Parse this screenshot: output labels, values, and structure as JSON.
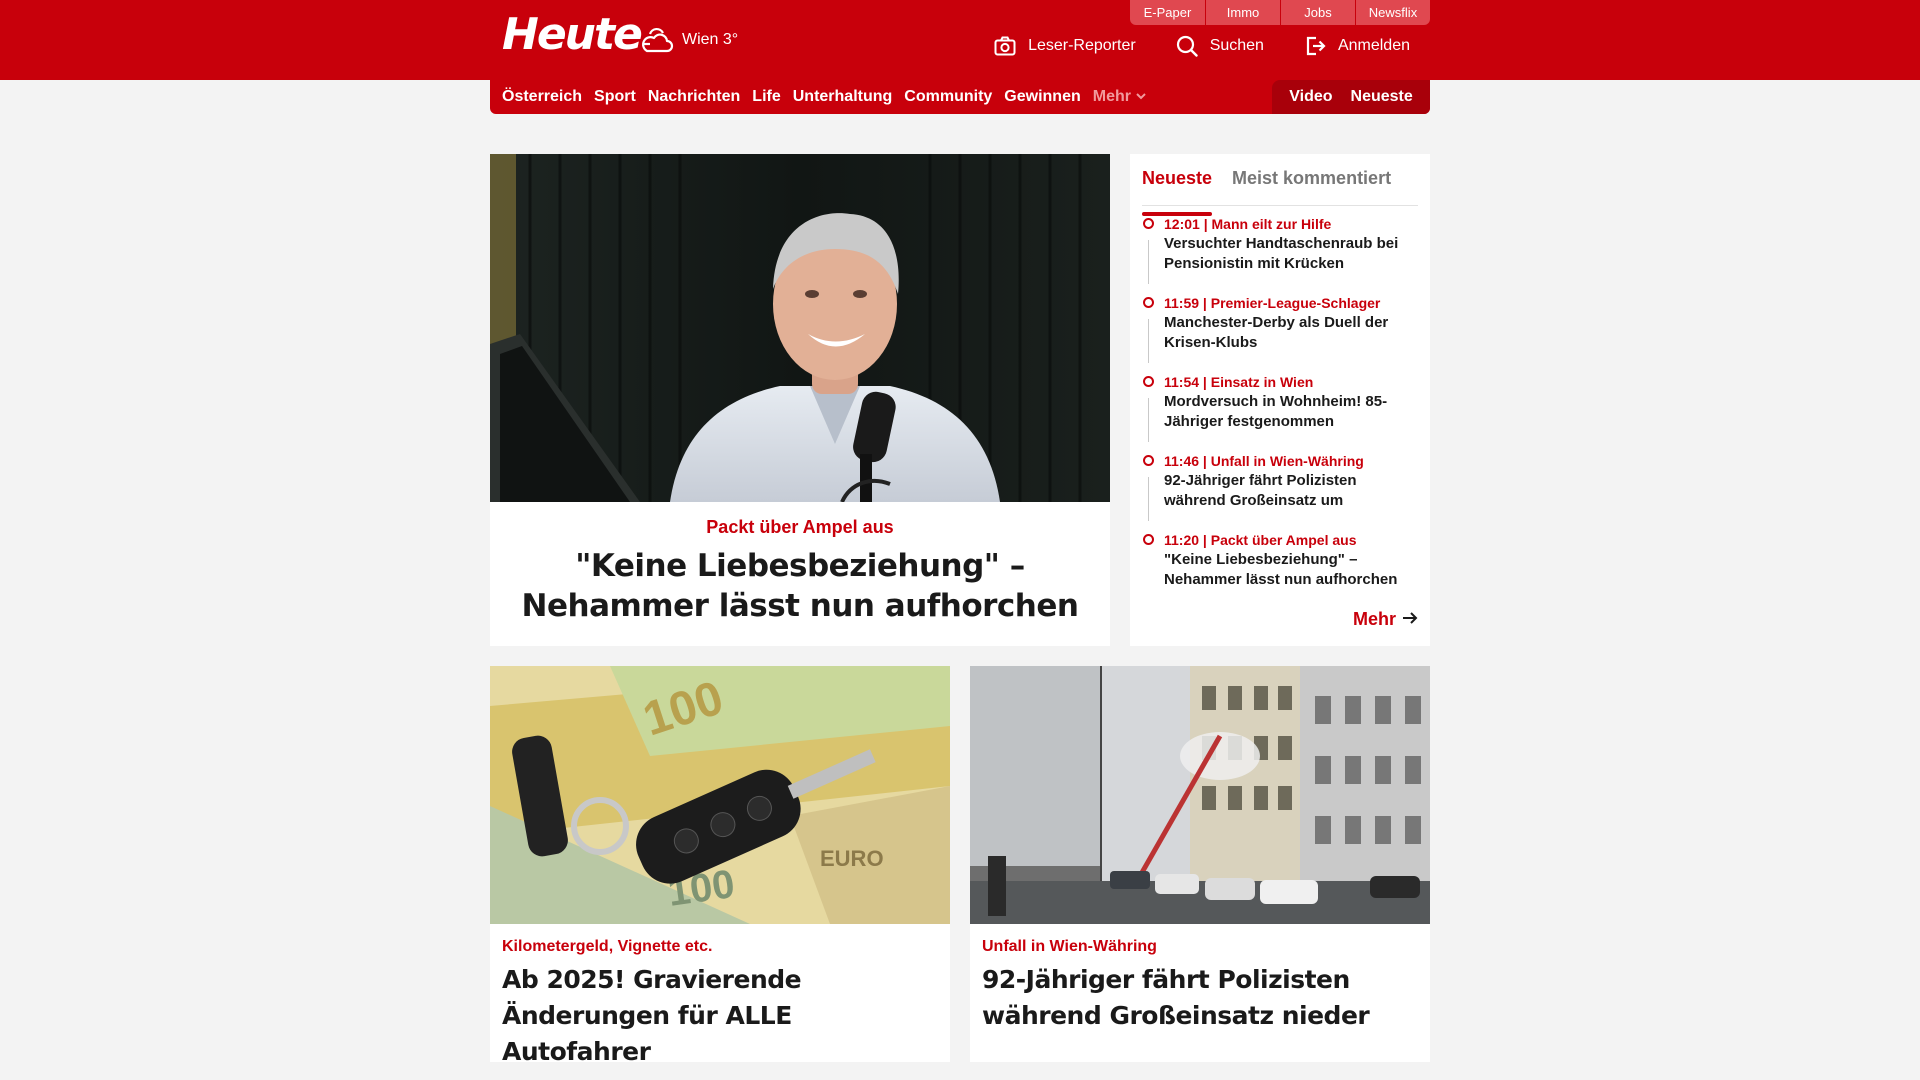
{
  "header": {
    "logo": "Heute",
    "weather": "Wien 3°",
    "top_links": [
      "E-Paper",
      "Immo",
      "Jobs",
      "Newsflix"
    ],
    "actions": {
      "reporter": "Leser-Reporter",
      "search": "Suchen",
      "login": "Anmelden"
    }
  },
  "nav": {
    "items": [
      "Österreich",
      "Sport",
      "Nachrichten",
      "Life",
      "Unterhaltung",
      "Community",
      "Gewinnen"
    ],
    "more": "Mehr",
    "right": [
      "Video",
      "Neueste"
    ]
  },
  "hero": {
    "kicker": "Packt über Ampel aus",
    "title": "\"Keine Liebesbeziehung\" – Nehammer lässt nun aufhorchen"
  },
  "latest": {
    "tabs": [
      "Neueste",
      "Meist kommentiert"
    ],
    "items": [
      {
        "meta": "12:01 | Mann eilt zur Hilfe",
        "title": "Versuchter Handtaschenraub bei Pensionistin mit Krücken"
      },
      {
        "meta": "11:59 | Premier-League-Schlager",
        "title": "Manchester-Derby als Duell der Krisen-Klubs"
      },
      {
        "meta": "11:54 | Einsatz in Wien",
        "title": "Mordversuch in Wohnheim! 85-Jähriger festgenommen"
      },
      {
        "meta": "11:46 | Unfall in Wien-Währing",
        "title": "92-Jähriger fährt Polizisten während Großeinsatz um"
      },
      {
        "meta": "11:20 | Packt über Ampel aus",
        "title": "\"Keine Liebesbeziehung\" – Nehammer lässt nun aufhorchen"
      }
    ],
    "more": "Mehr"
  },
  "cards": [
    {
      "kicker": "Kilometergeld, Vignette etc.",
      "title": "Ab 2025! Gravierende Änderungen für ALLE Autofahrer"
    },
    {
      "kicker": "Unfall in Wien-Währing",
      "title": "92-Jähriger fährt Polizisten während Großeinsatz nieder"
    }
  ],
  "colors": {
    "brand": "#c8000b",
    "brand_dark": "#a8000a",
    "background": "#f3f3f3"
  },
  "icons": [
    "weather-cloud-sun-icon",
    "camera-icon",
    "search-icon",
    "login-icon",
    "chevron-down-icon",
    "arrow-right-icon"
  ]
}
